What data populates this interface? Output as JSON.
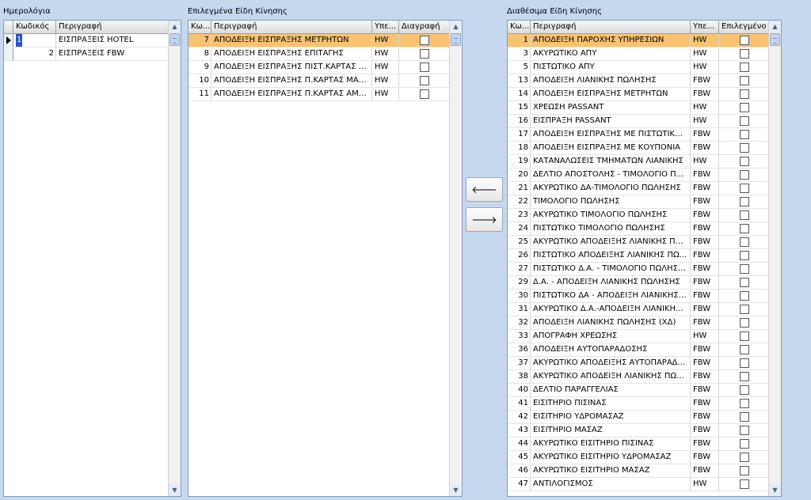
{
  "journals": {
    "title": "Ημερολόγια",
    "headers": [
      "",
      "Κωδικός",
      "Περιγραφή"
    ],
    "rows": [
      {
        "code": "1",
        "desc": "ΕΙΣΠΡΑΞΕΙΣ HOTEL"
      },
      {
        "code": "2",
        "desc": "ΕΙΣΠΡΑΞΕΙΣ FBW"
      }
    ]
  },
  "selected_types": {
    "title": "Επιλεγμένα Είδη Κίνησης",
    "headers": [
      "Κω...",
      "Περιγραφή",
      "Υπε...",
      "Διαγραφή"
    ],
    "rows": [
      {
        "code": "7",
        "desc": "ΑΠΟΔΕΙΞΗ ΕΙΣΠΡΑΞΗΣ ΜΕΤΡΗΤΩΝ",
        "type": "HW"
      },
      {
        "code": "8",
        "desc": "ΑΠΟΔΕΙΞΗ ΕΙΣΠΡΑΞΗΣ ΕΠΙΤΑΓΗΣ",
        "type": "HW"
      },
      {
        "code": "9",
        "desc": "ΑΠΟΔΕΙΞΗ ΕΙΣΠΡΑΞΗΣ ΠΙΣΤ.ΚΑΡΤΑΣ V...",
        "type": "HW"
      },
      {
        "code": "10",
        "desc": "ΑΠΟΔΕΙΞΗ ΕΙΣΠΡΑΞΗΣ Π.ΚΑΡΤΑΣ MAS...",
        "type": "HW"
      },
      {
        "code": "11",
        "desc": "ΑΠΟΔΕΙΞΗ ΕΙΣΠΡΑΞΗΣ Π.ΚΑΡΤΑΣ ΑΜΕ...",
        "type": "HW"
      }
    ]
  },
  "buttons": {
    "add_icon": "arrow-left-icon",
    "add_glyph": "🡐",
    "remove_icon": "arrow-right-icon",
    "remove_glyph": "🡒"
  },
  "available_types": {
    "title": "Διαθέσιμα Είδη Κίνησης",
    "headers": [
      "Κω...",
      "Περιγραφή",
      "Υπε...",
      "Επιλεγμένο"
    ],
    "rows": [
      {
        "code": "1",
        "desc": "ΑΠΟΔΕΙΞΗ ΠΑΡΟΧΗΣ ΥΠΗΡΕΣΙΩΝ",
        "type": "HW"
      },
      {
        "code": "3",
        "desc": "ΑΚΥΡΩΤΙΚΟ ΑΠΥ",
        "type": "HW"
      },
      {
        "code": "5",
        "desc": "ΠΙΣΤΩΤΙΚΟ ΑΠΥ",
        "type": "HW"
      },
      {
        "code": "13",
        "desc": "ΑΠΟΔΕΙΞΗ ΛΙΑΝΙΚΗΣ ΠΩΛΗΣΗΣ",
        "type": "FBW"
      },
      {
        "code": "14",
        "desc": "ΑΠΟΔΕΙΞΗ ΕΙΣΠΡΑΞΗΣ ΜΕΤΡΗΤΩΝ",
        "type": "FBW"
      },
      {
        "code": "15",
        "desc": "ΧΡΕΩΣΗ PASSANT",
        "type": "HW"
      },
      {
        "code": "16",
        "desc": "ΕΙΣΠΡΑΞΗ PASSANT",
        "type": "HW"
      },
      {
        "code": "17",
        "desc": "ΑΠΟΔΕΙΞΗ ΕΙΣΠΡΑΞΗΣ ΜΕ ΠΙΣΤΩΤΙΚΗ ...",
        "type": "FBW"
      },
      {
        "code": "18",
        "desc": "ΑΠΟΔΕΙΞΗ ΕΙΣΠΡΑΞΗΣ ΜΕ ΚΟΥΠΟΝΙΑ",
        "type": "FBW"
      },
      {
        "code": "19",
        "desc": "ΚΑΤΑΝΑΛΩΣΕΙΣ ΤΜΗΜΑΤΩΝ ΛΙΑΝΙΚΗΣ",
        "type": "HW"
      },
      {
        "code": "20",
        "desc": "ΔΕΛΤΙΟ ΑΠΟΣΤΟΛΗΣ - ΤΙΜΟΛΟΓΙΟ Π...",
        "type": "FBW"
      },
      {
        "code": "21",
        "desc": "ΑΚΥΡΩΤΙΚΟ ΔΑ-ΤΙΜΟΛΟΓΙΟ ΠΩΛΗΣΗΣ",
        "type": "FBW"
      },
      {
        "code": "22",
        "desc": "ΤΙΜΟΛΟΓΙΟ ΠΩΛΗΣΗΣ",
        "type": "FBW"
      },
      {
        "code": "23",
        "desc": "ΑΚΥΡΩΤΙΚΟ ΤΙΜΟΛΟΓΙΟ ΠΩΛΗΣΗΣ",
        "type": "FBW"
      },
      {
        "code": "24",
        "desc": "ΠΙΣΤΩΤΙΚΟ ΤΙΜΟΛΟΓΙΟ ΠΩΛΗΣΗΣ",
        "type": "FBW"
      },
      {
        "code": "25",
        "desc": "ΑΚΥΡΩΤΙΚΟ ΑΠΟΔΕΙΞΗΣ ΛΙΑΝΙΚΗΣ ΠΩ...",
        "type": "FBW"
      },
      {
        "code": "26",
        "desc": "ΠΙΣΤΩΤΙΚΟ ΑΠΟΔΕΙΞΗΣ ΛΙΑΝΙΚΗΣ ΠΩ...",
        "type": "FBW"
      },
      {
        "code": "27",
        "desc": "ΠΙΣΤΩΤΙΚΟ Δ.Α. - ΤΙΜΟΛΟΓΙΟ ΠΩΛΗΣΗΣ",
        "type": "FBW"
      },
      {
        "code": "29",
        "desc": "Δ.Α. - ΑΠΟΔΕΙΞΗ ΛΙΑΝΙΚΗΣ ΠΩΛΗΣΗΣ",
        "type": "FBW"
      },
      {
        "code": "30",
        "desc": "ΠΙΣΤΩΤΙΚΟ ΔΑ - ΑΠΟΔΕΙΞΗ ΛΙΑΝΙΚΗΣ ...",
        "type": "FBW"
      },
      {
        "code": "31",
        "desc": "ΑΚΥΡΩΤΙΚΟ Δ.Α.-ΑΠΟΔΕΙΞΗ ΛΙΑΝΙΚΗ...",
        "type": "FBW"
      },
      {
        "code": "32",
        "desc": "ΑΠΟΔΕΙΞΗ ΛΙΑΝΙΚΗΣ ΠΩΛΗΣΗΣ (ΧΔ)",
        "type": "FBW"
      },
      {
        "code": "33",
        "desc": "ΑΠΟΓΡΑΦΗ ΧΡΕΩΣΗΣ",
        "type": "HW"
      },
      {
        "code": "36",
        "desc": "ΑΠΟΔΕΙΞΗ ΑΥΤΟΠΑΡΑΔΟΣΗΣ",
        "type": "FBW"
      },
      {
        "code": "37",
        "desc": "ΑΚΥΡΩΤΙΚΟ ΑΠΟΔΕΙΞΗΣ ΑΥΤΟΠΑΡΑΔ...",
        "type": "FBW"
      },
      {
        "code": "38",
        "desc": "ΑΚΥΡΩΤΙΚΟ ΑΠΟΔΕΙΞΗ ΛΙΑΝΙΚΗΣ ΠΩΛ...",
        "type": "FBW"
      },
      {
        "code": "40",
        "desc": "ΔΕΛΤΙΟ ΠΑΡΑΓΓΕΛΙΑΣ",
        "type": "FBW"
      },
      {
        "code": "41",
        "desc": "ΕΙΣΙΤΗΡΙΟ ΠΙΣΙΝΑΣ",
        "type": "FBW"
      },
      {
        "code": "42",
        "desc": "ΕΙΣΙΤΗΡΙΟ ΥΔΡΟΜΑΣΑΖ",
        "type": "FBW"
      },
      {
        "code": "43",
        "desc": "ΕΙΣΙΤΗΡΙΟ ΜΑΣΑΖ",
        "type": "FBW"
      },
      {
        "code": "44",
        "desc": "ΑΚΥΡΩΤΙΚΟ ΕΙΣΙΤΗΡΙΟ ΠΙΣΙΝΑΣ",
        "type": "FBW"
      },
      {
        "code": "45",
        "desc": "ΑΚΥΡΩΤΙΚΟ ΕΙΣΙΤΗΡΙΟ ΥΔΡΟΜΑΣΑΖ",
        "type": "FBW"
      },
      {
        "code": "46",
        "desc": "ΑΚΥΡΩΤΙΚΟ ΕΙΣΙΤΗΡΙΟ ΜΑΣΑΖ",
        "type": "FBW"
      },
      {
        "code": "47",
        "desc": "ΑΝΤΙΛΟΓΙΣΜΟΣ",
        "type": "HW"
      }
    ]
  },
  "colors": {
    "background": "#c5d8ee",
    "selected_row": "#f8c370",
    "edit_cell": "#2b55c4"
  }
}
